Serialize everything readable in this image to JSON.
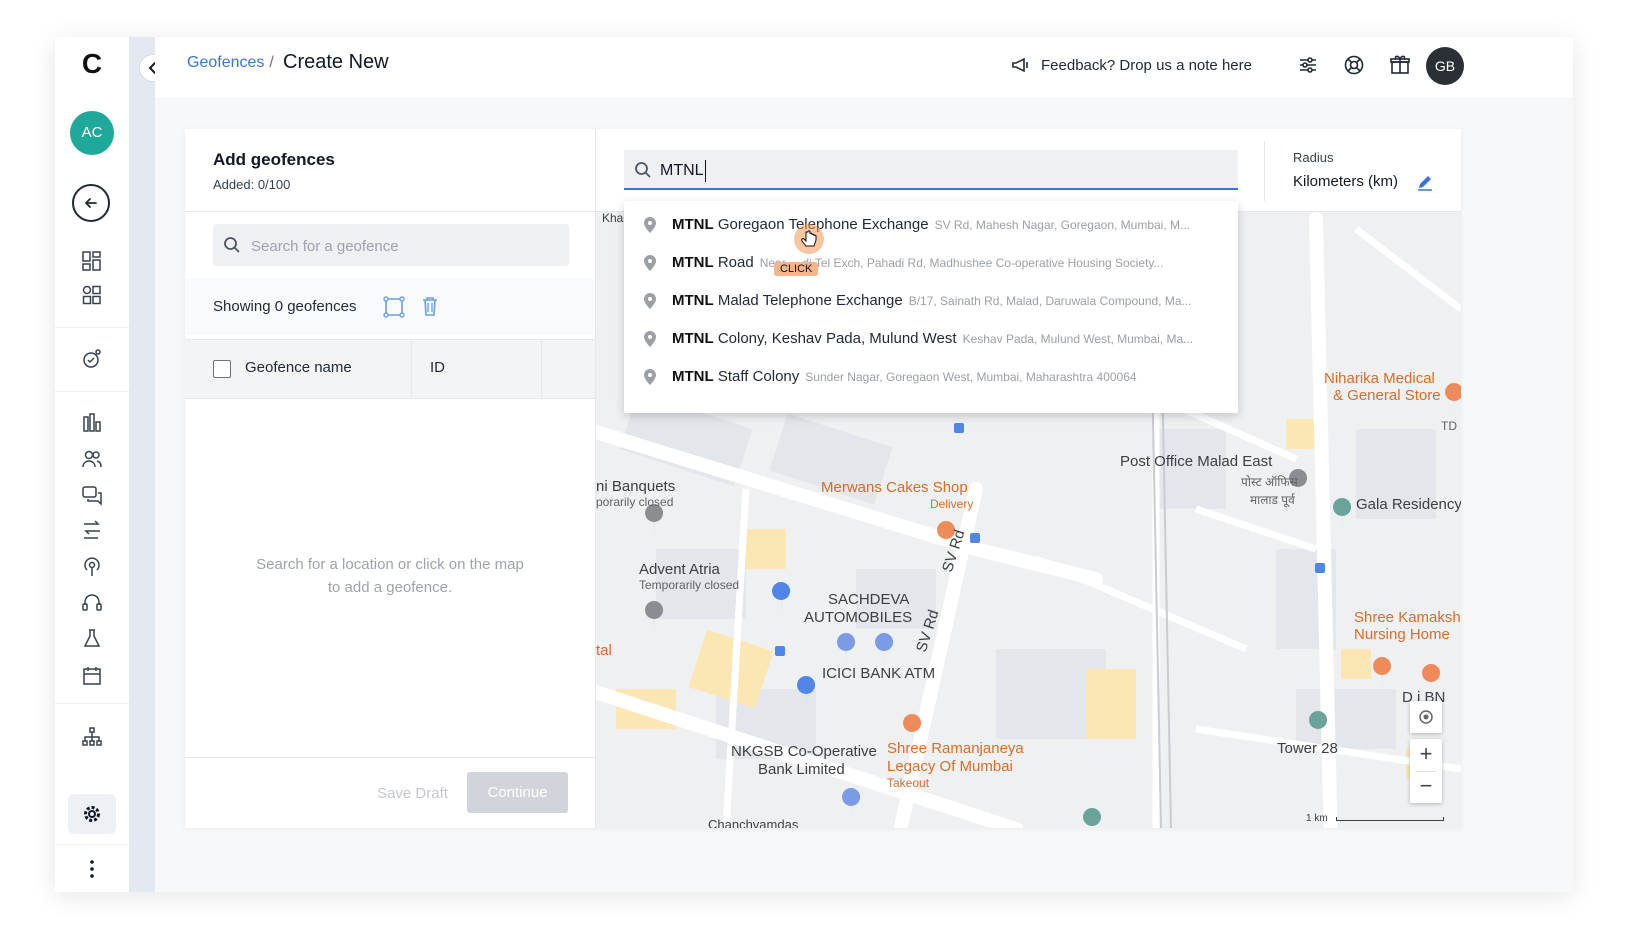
{
  "sidebar": {
    "logo": "C",
    "avatar_initials": "AC",
    "items": [
      {
        "icon": "dashboard-icon"
      },
      {
        "icon": "apps-icon"
      },
      {
        "icon": "campaign-icon"
      },
      {
        "icon": "analytics-icon"
      },
      {
        "icon": "users-icon"
      },
      {
        "icon": "messages-icon"
      },
      {
        "icon": "journeys-icon"
      },
      {
        "icon": "broadcast-icon"
      },
      {
        "icon": "support-icon"
      },
      {
        "icon": "experiments-icon"
      },
      {
        "icon": "calendar-icon"
      },
      {
        "icon": "hierarchy-icon"
      },
      {
        "icon": "settings-icon"
      },
      {
        "icon": "more-icon"
      }
    ]
  },
  "header": {
    "breadcrumb_parent": "Geofences",
    "breadcrumb_sep": "/",
    "title": "Create New",
    "feedback_text": "Feedback? Drop us a note here",
    "avatar_initials": "GB"
  },
  "left_panel": {
    "title": "Add geofences",
    "added": "Added: 0/100",
    "search_placeholder": "Search for a geofence",
    "showing": "Showing 0 geofences",
    "columns": [
      "Geofence name",
      "ID"
    ],
    "empty_message_line1": "Search for a location or click on the map",
    "empty_message_line2": "to add a geofence.",
    "save_draft": "Save Draft",
    "continue": "Continue"
  },
  "map_panel": {
    "search_value": "MTNL",
    "radius_label": "Radius",
    "radius_value": "Kilometers (km)",
    "suggestions": [
      {
        "bold": "MTNL",
        "rest": "Goregaon Telephone Exchange",
        "address": "SV Rd, Mahesh Nagar, Goregaon, Mumbai, M..."
      },
      {
        "bold": "MTNL",
        "rest": "Road",
        "address": "Near ... di Tel Exch, Pahadi Rd, Madhushee Co-operative Housing Society..."
      },
      {
        "bold": "MTNL",
        "rest": "Malad Telephone Exchange",
        "address": "B/17, Sainath Rd, Malad, Daruwala Compound, Ma..."
      },
      {
        "bold": "MTNL",
        "rest": "Colony, Keshav Pada, Mulund West",
        "address": "Keshav Pada, Mulund West, Mumbai, Ma..."
      },
      {
        "bold": "MTNL",
        "rest": "Staff Colony",
        "address": "Sunder Nagar, Goregaon West, Mumbai, Maharashtra 400064"
      }
    ],
    "click_label": "CLICK",
    "places": {
      "niharika": "Niharika Medical",
      "niharika2": "& General Store",
      "post_office": "Post Office Malad East",
      "post_hindi1": "पोस्ट ऑफिस",
      "post_hindi2": "मालाड पूर्व",
      "gala": "Gala Residency",
      "banquets": "ni Banquets",
      "banquets_sub": "porarily closed",
      "merwans": "Merwans Cakes Shop",
      "merwans_sub": "Delivery",
      "advent": "Advent Atria",
      "advent_sub": "Temporarily closed",
      "sachdeva1": "SACHDEVA",
      "sachdeva2": "AUTOMOBILES",
      "sv_rd": "SV Rd",
      "shree_k1": "Shree Kamaksh",
      "shree_k2": "Nursing Home",
      "tal": "tal",
      "icici": "ICICI BANK ATM",
      "tower": "Tower 28",
      "nkgsb1": "NKGSB Co-Operative",
      "nkgsb2": "Bank Limited",
      "ramanjaneya1": "Shree Ramanjaneya",
      "ramanjaneya2": "Legacy Of Mumbai",
      "ramanjaneya_sub": "Takeout",
      "chanchvamdas": "Chanchvamdas",
      "kha": "Kha",
      "devi": "D  i BN",
      "td": "TD"
    },
    "scale": "1 km"
  },
  "colors": {
    "accent": "#3b74d6",
    "teal_avatar": "#1fa99a",
    "dark_avatar": "#2b2f36",
    "map_orange": "#d56e2a"
  }
}
